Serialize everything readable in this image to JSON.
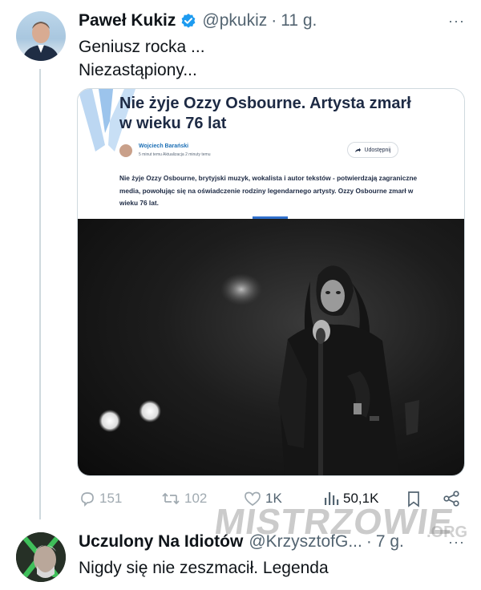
{
  "tweet": {
    "author_name": "Paweł Kukiz",
    "handle": "@pkukiz",
    "separator": "·",
    "time": "11 g.",
    "more_label": "···",
    "text_lines": [
      "Geniusz rocka ...",
      "Niezastąpiony..."
    ],
    "article": {
      "title": "Nie żyje Ozzy Osbourne. Artysta zmarł w wieku 76 lat",
      "author": "Wojciech Barański",
      "meta": "5 minut temu Aktualizacja 2 minuty temu",
      "share_label": "Udostępnij",
      "lead": "Nie żyje Ozzy Osbourne, brytyjski muzyk, wokalista i autor tekstów - potwierdzają zagraniczne media, powołując się na oświadczenie rodziny legendarnego artysty. Ozzy Osbourne zmarł w wieku 76 lat."
    },
    "actions": {
      "replies": "151",
      "retweets": "102",
      "likes": "1K",
      "views": "50,1K"
    }
  },
  "reply": {
    "author_name": "Uczulony Na Idiotów",
    "handle": "@KrzysztofG...",
    "separator": "·",
    "time": "7 g.",
    "more_label": "···",
    "text": "Nigdy się nie zeszmacił. Legenda"
  },
  "watermark": {
    "text": "MISTRZOWIE",
    "suffix": ".ORG"
  },
  "colors": {
    "verified_blue": "#1d9bf0",
    "muted_text": "#536471",
    "thread_line": "#cfd9de"
  }
}
